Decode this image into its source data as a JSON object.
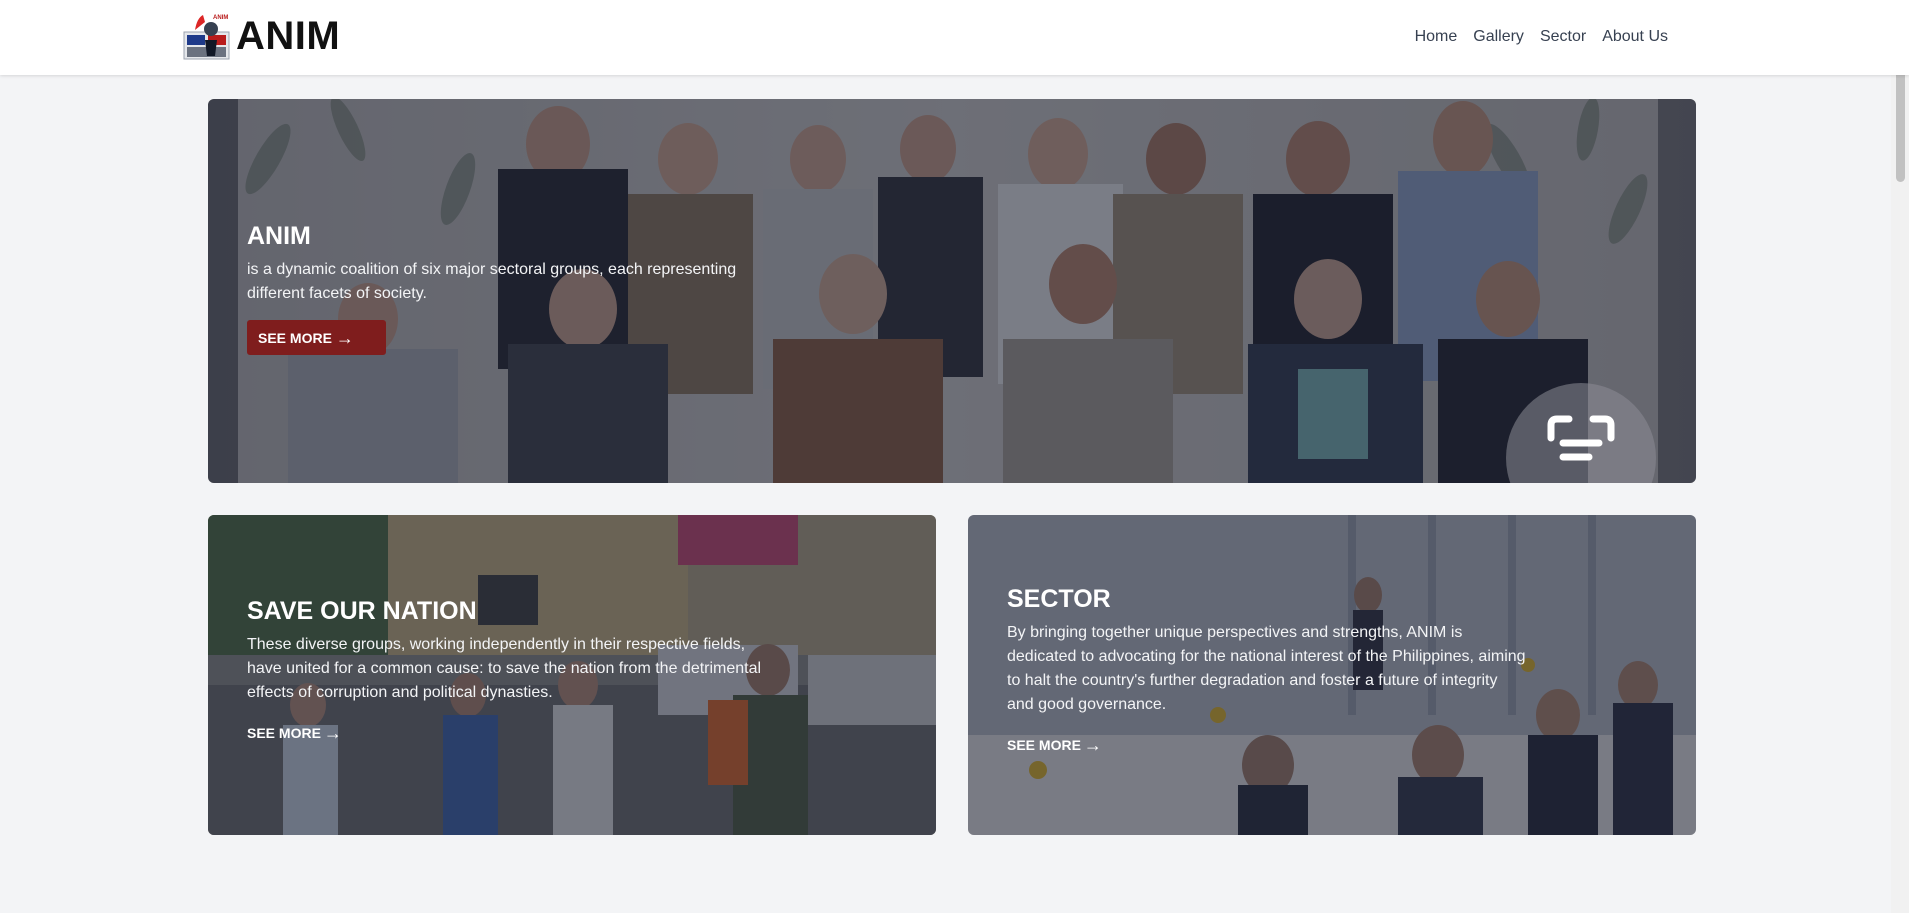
{
  "brand": {
    "name": "ANIM",
    "emblem_text": "ANIM"
  },
  "nav": {
    "items": [
      {
        "label": "Home"
      },
      {
        "label": "Gallery"
      },
      {
        "label": "Sector"
      },
      {
        "label": "About Us"
      }
    ]
  },
  "hero": {
    "title": "ANIM",
    "description": "is a dynamic coalition of six major sectoral groups, each representing different facets of society.",
    "button_label": "SEE MORE"
  },
  "card_nation": {
    "title": "SAVE OUR NATION",
    "description": "These diverse groups, working independently in their respective fields, have united for a common cause: to save the nation from the detrimental effects of corruption and political dynasties.",
    "link_label": "SEE MORE"
  },
  "card_sector": {
    "title": "SECTOR",
    "description": "By bringing together unique perspectives and strengths, ANIM is dedicated to advocating for the national interest of the Philippines, aiming to halt the country's further degradation and foster a future of integrity and good governance.",
    "link_label": "SEE MORE"
  },
  "icons": {
    "arrow": "→",
    "scan": "scan-icon"
  },
  "colors": {
    "accent": "#7f1d1d",
    "overlay": "#1e2337",
    "background": "#f3f4f6"
  }
}
